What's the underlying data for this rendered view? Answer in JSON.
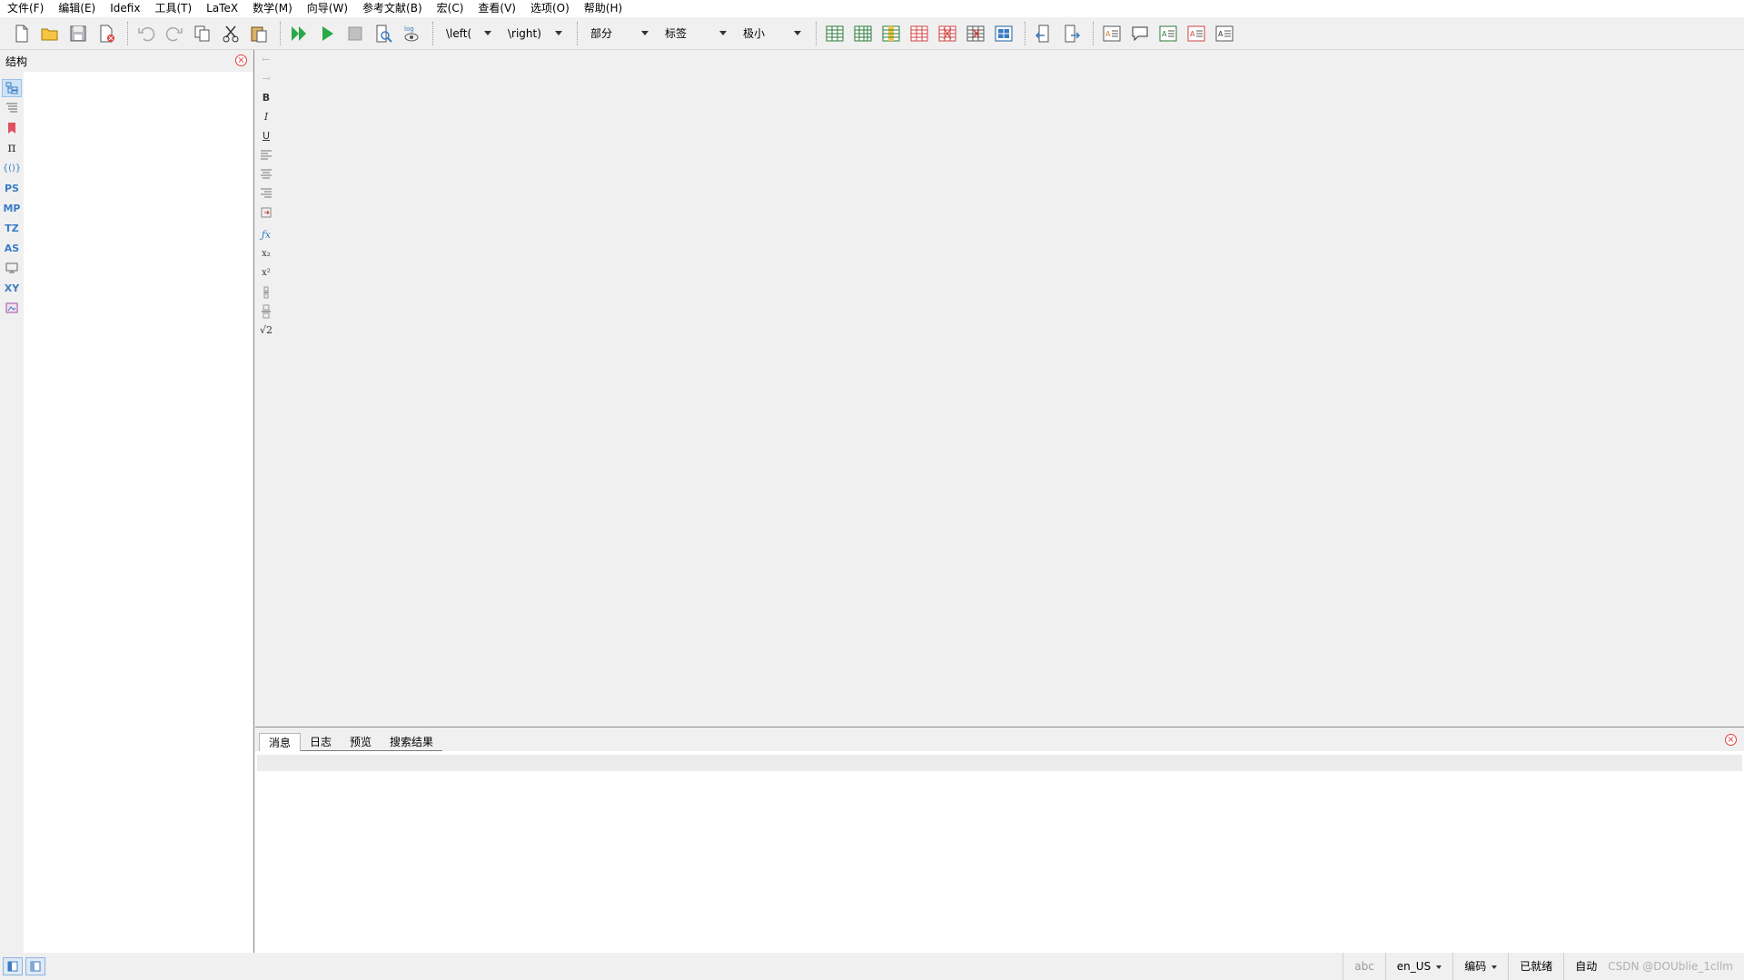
{
  "menu": [
    "文件(F)",
    "编辑(E)",
    "Idefix",
    "工具(T)",
    "LaTeX",
    "数学(M)",
    "向导(W)",
    "参考文献(B)",
    "宏(C)",
    "查看(V)",
    "选项(O)",
    "帮助(H)"
  ],
  "toolbar": {
    "combo_left": "\\left(",
    "combo_right": "\\right)",
    "combo_section": "部分",
    "combo_label": "标签",
    "combo_size": "极小"
  },
  "structure_panel": {
    "title": "结构"
  },
  "sidebar_labels": {
    "ps": "PS",
    "mp": "MP",
    "tz": "TZ",
    "as": "AS",
    "xy": "XY",
    "pi": "π",
    "braces": "{()}"
  },
  "editor_vbar": {
    "back": "←",
    "forward": "→",
    "bold": "B",
    "italic": "I",
    "underline": "U",
    "fx": "ƒx",
    "sub": "x₂",
    "sup": "x²",
    "sqrt": "√2"
  },
  "messages_panel": {
    "tabs": [
      "消息",
      "日志",
      "预览",
      "搜索结果"
    ]
  },
  "statusbar": {
    "spell": "abc",
    "language": "en_US",
    "encoding": "编码",
    "ready": "已就绪",
    "auto": "自动",
    "watermark": "CSDN @DOUblie_1cllm"
  },
  "colors": {
    "accent": "#3a7cc3",
    "close": "#e04040",
    "run_green": "#2aa84a"
  }
}
